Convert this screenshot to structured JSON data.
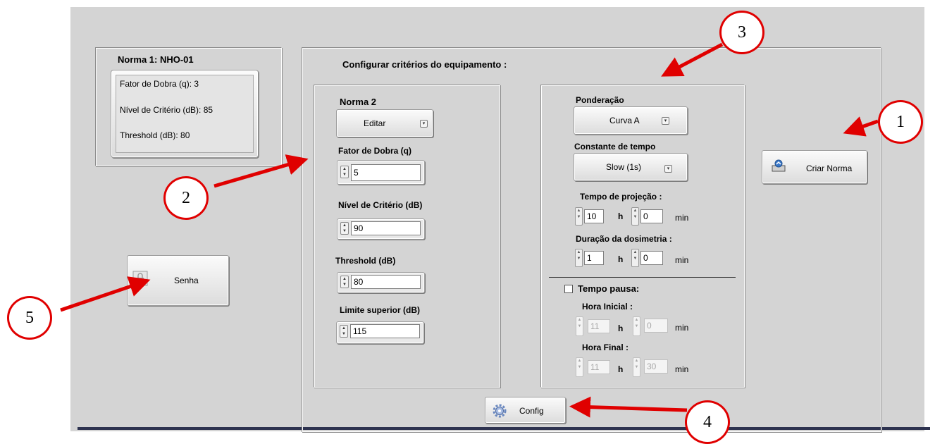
{
  "norma1": {
    "title": "Norma 1: NHO-01",
    "fator": "Fator de Dobra (q): 3",
    "nivel": "Nível de Critério (dB): 85",
    "threshold": "Threshold (dB): 80"
  },
  "config_title": "Configurar critérios do equipamento :",
  "norma2": {
    "title": "Norma 2",
    "editar": "Editar",
    "fator_label": "Fator de Dobra (q)",
    "fator_value": "5",
    "nivel_label": "Nível de Critério (dB)",
    "nivel_value": "90",
    "threshold_label": "Threshold (dB)",
    "threshold_value": "80",
    "limite_label": "Limite superior (dB)",
    "limite_value": "115"
  },
  "right": {
    "ponderacao_label": "Ponderação",
    "ponderacao_value": "Curva A",
    "constante_label": "Constante de tempo",
    "constante_value": "Slow (1s)",
    "projecao_label": "Tempo de projeção :",
    "projecao_h": "10",
    "projecao_min": "0",
    "duracao_label": "Duração da dosimetria :",
    "duracao_h": "1",
    "duracao_min": "0",
    "h_unit": "h",
    "min_unit": "min",
    "pausa_label": "Tempo pausa:",
    "hora_inicial_label": "Hora Inicial :",
    "inicial_h": "11",
    "inicial_min": "0",
    "hora_final_label": "Hora Final :",
    "final_h": "11",
    "final_min": "30"
  },
  "buttons": {
    "criar_norma": "Criar Norma",
    "senha": "Senha",
    "config": "Config"
  },
  "callouts": [
    "1",
    "2",
    "3",
    "4",
    "5"
  ],
  "colors": {
    "annotation": "#e00000",
    "panel": "#d4d4d4"
  }
}
